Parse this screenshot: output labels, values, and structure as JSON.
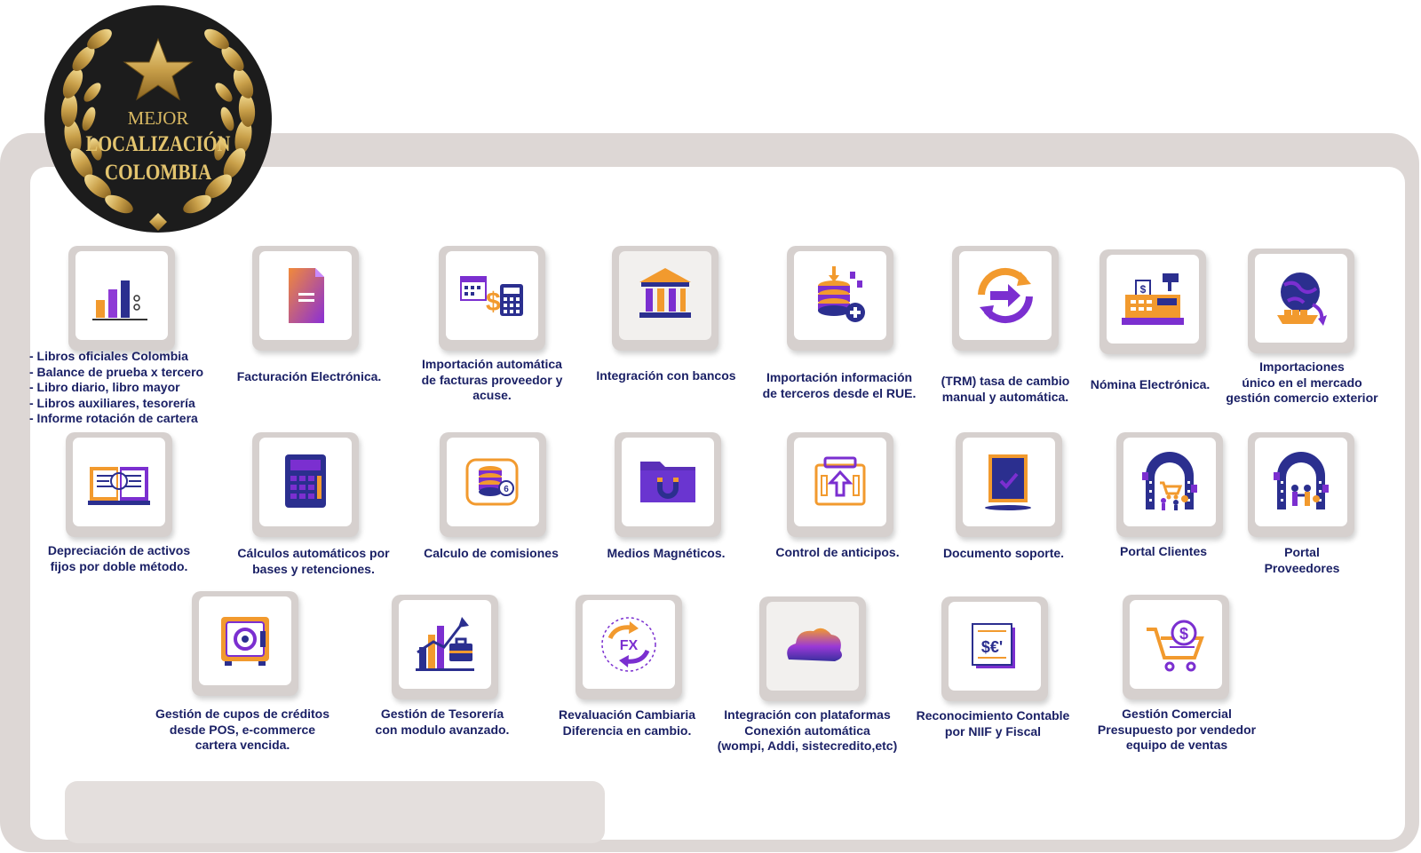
{
  "badge": {
    "line1": "MEJOR",
    "line2": "LOCALIZACIÓN",
    "line3": "COLOMBIA"
  },
  "features": [
    {
      "icon": "bar-chart-icon",
      "lines": [
        "- Libros oficiales Colombia",
        "- Balance de prueba x tercero",
        "- Libro diario, libro mayor",
        "- Libros auxiliares, tesorería",
        "- Informe rotación de cartera"
      ]
    },
    {
      "icon": "document-icon",
      "lines": [
        "Facturación Electrónica."
      ]
    },
    {
      "icon": "calendar-calculator-icon",
      "lines": [
        "Importación automática",
        "de facturas proveedor y",
        "acuse."
      ]
    },
    {
      "icon": "bank-icon",
      "lines": [
        "Integración con bancos"
      ]
    },
    {
      "icon": "database-add-icon",
      "lines": [
        "Importación información",
        "de terceros desde el RUE."
      ]
    },
    {
      "icon": "exchange-arrows-icon",
      "lines": [
        "(TRM) tasa de cambio",
        "manual y automática."
      ]
    },
    {
      "icon": "cash-register-icon",
      "lines": [
        "Nómina Electrónica."
      ]
    },
    {
      "icon": "globe-ship-icon",
      "lines": [
        "Importaciones",
        "único en el mercado",
        "gestión comercio exterior"
      ]
    },
    {
      "icon": "open-book-icon",
      "lines": [
        "Depreciación de activos",
        "fijos por doble método."
      ]
    },
    {
      "icon": "calculator-icon",
      "lines": [
        "Cálculos automáticos por",
        "bases y retenciones."
      ]
    },
    {
      "icon": "coins-icon",
      "lines": [
        "Calculo de comisiones"
      ]
    },
    {
      "icon": "magnet-folder-icon",
      "lines": [
        "Medios Magnéticos."
      ]
    },
    {
      "icon": "upload-box-icon",
      "lines": [
        "Control de anticipos."
      ]
    },
    {
      "icon": "checked-document-icon",
      "lines": [
        "Documento soporte."
      ]
    },
    {
      "icon": "customer-portal-icon",
      "lines": [
        "Portal Clientes"
      ]
    },
    {
      "icon": "supplier-portal-icon",
      "lines": [
        "Portal",
        "Proveedores"
      ]
    },
    {
      "icon": "safe-icon",
      "lines": [
        "Gestión de cupos de créditos",
        "desde POS, e-commerce",
        "cartera vencida."
      ]
    },
    {
      "icon": "growth-briefcase-icon",
      "lines": [
        "Gestión de Tesorería",
        "con modulo avanzado."
      ]
    },
    {
      "icon": "fx-exchange-icon",
      "lines": [
        "Revaluación Cambiaria",
        "Diferencia en cambio."
      ]
    },
    {
      "icon": "cloud-icon",
      "lines": [
        "Integración con plataformas",
        "Conexión automática",
        "(wompi, Addi, sistecredito,etc)"
      ]
    },
    {
      "icon": "currency-book-icon",
      "lines": [
        "Reconocimiento Contable",
        "por NIIF y Fiscal"
      ]
    },
    {
      "icon": "shopping-cart-dollar-icon",
      "lines": [
        "Gestión Comercial",
        "Presupuesto por vendedor",
        "equipo de ventas"
      ]
    }
  ],
  "colors": {
    "label": "#1b2166",
    "purple": "#7b2fd0",
    "orange": "#f29a2e",
    "navy": "#2b2f8f",
    "gold": "#d4b15a",
    "badge_bg": "#1c1c1c"
  }
}
